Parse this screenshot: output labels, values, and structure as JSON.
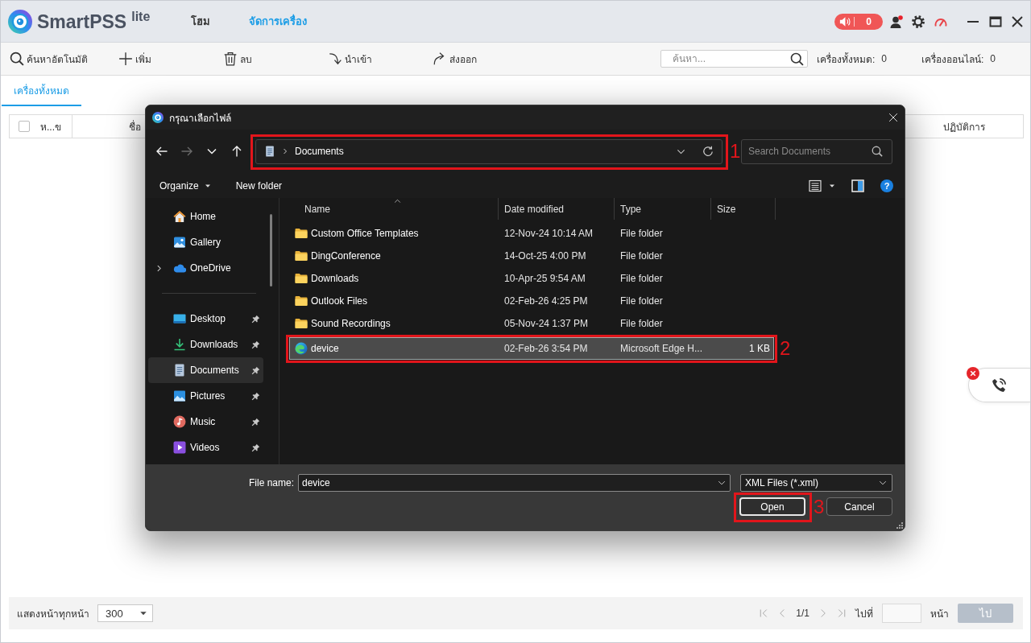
{
  "app": {
    "logo": "SmartPSS$^{lite}$",
    "nav_tabs": [
      {
        "label": "โฮม",
        "selected": false
      },
      {
        "label": "จัดการเครื่อง",
        "selected": true
      }
    ],
    "alarm_count": "0"
  },
  "toolbar": {
    "actions": [
      {
        "kind": "search",
        "label": "ค้นหาอัตโนมัติ"
      },
      {
        "kind": "add",
        "label": "เพิ่ม"
      },
      {
        "kind": "delete",
        "label": "ลบ"
      },
      {
        "kind": "import",
        "label": "นำเข้า"
      },
      {
        "kind": "export",
        "label": "ส่งออก"
      }
    ],
    "search": {
      "placeholder": "ค้นหา..."
    },
    "stats": [
      {
        "label": "เครื่องทั้งหมด:",
        "value": "0"
      },
      {
        "label": "เครื่องออนไลน์:",
        "value": "0"
      }
    ]
  },
  "tabs": [
    {
      "label": "เครื่องทั้งหมด",
      "selected": true
    }
  ],
  "table": {
    "select_all_checked": false,
    "columns": [
      "ห...ข",
      "ชื่อ",
      "ปฏิบัติการ"
    ]
  },
  "pagination": {
    "page_size_label": "แสดงหน้าทุกหน้า",
    "page_size": "300",
    "page": "1/1",
    "goto_label": "ไปที่",
    "page_unit": "หน้า",
    "go_button": {
      "label": "ไป",
      "disabled": true
    }
  },
  "file_dialog": {
    "title": "กรุณาเลือกไฟล์",
    "nav_buttons": [
      {
        "kind": "back",
        "disabled": false
      },
      {
        "kind": "forward",
        "disabled": true
      },
      {
        "kind": "recent",
        "disabled": false
      },
      {
        "kind": "up",
        "disabled": false
      }
    ],
    "address_bar": {
      "path": [
        "Documents"
      ],
      "callout": "1"
    },
    "search": {
      "placeholder": "Search Documents"
    },
    "commands": [
      {
        "label": "Organize",
        "has_menu": true
      },
      {
        "label": "New folder",
        "has_menu": false
      }
    ],
    "help": "?",
    "sidebar": {
      "sections": [
        {
          "items": [
            {
              "kind": "home",
              "label": "Home",
              "expandable": false,
              "pinned": false,
              "selected": false
            },
            {
              "kind": "gallery",
              "label": "Gallery",
              "expandable": false,
              "pinned": false,
              "selected": false
            },
            {
              "kind": "onedrive",
              "label": "OneDrive",
              "expandable": true,
              "pinned": false,
              "selected": false
            }
          ]
        },
        {
          "items": [
            {
              "kind": "desktop",
              "label": "Desktop",
              "expandable": false,
              "pinned": true,
              "selected": false
            },
            {
              "kind": "downloads",
              "label": "Downloads",
              "expandable": false,
              "pinned": true,
              "selected": false
            },
            {
              "kind": "documents",
              "label": "Documents",
              "expandable": false,
              "pinned": true,
              "selected": true
            },
            {
              "kind": "pictures",
              "label": "Pictures",
              "expandable": false,
              "pinned": true,
              "selected": false
            },
            {
              "kind": "music",
              "label": "Music",
              "expandable": false,
              "pinned": true,
              "selected": false
            },
            {
              "kind": "videos",
              "label": "Videos",
              "expandable": false,
              "pinned": true,
              "selected": false
            }
          ]
        }
      ]
    },
    "columns": [
      {
        "label": "Name",
        "sorted": true
      },
      {
        "label": "Date modified",
        "sorted": false
      },
      {
        "label": "Type",
        "sorted": false
      },
      {
        "label": "Size",
        "sorted": false
      }
    ],
    "files": [
      {
        "kind": "folder",
        "name": "Custom Office Templates",
        "date": "12-Nov-24 10:14 AM",
        "type": "File folder",
        "selected": false
      },
      {
        "kind": "folder",
        "name": "DingConference",
        "date": "14-Oct-25 4:00 PM",
        "type": "File folder",
        "selected": false
      },
      {
        "kind": "folder",
        "name": "Downloads",
        "date": "10-Apr-25 9:54 AM",
        "type": "File folder",
        "selected": false
      },
      {
        "kind": "folder",
        "name": "Outlook Files",
        "date": "02-Feb-26 4:25 PM",
        "type": "File folder",
        "selected": false
      },
      {
        "kind": "folder",
        "name": "Sound Recordings",
        "date": "05-Nov-24 1:37 PM",
        "type": "File folder",
        "selected": false
      },
      {
        "kind": "edge-document",
        "name": "device",
        "date": "02-Feb-26 3:54 PM",
        "type": "Microsoft Edge H...",
        "size": "1 KB",
        "selected": true,
        "callout": "2"
      }
    ],
    "file_name": {
      "label": "File name:",
      "value": "device"
    },
    "file_type": "XML Files (*.xml)",
    "buttons": [
      {
        "label": "Open",
        "default": true,
        "callout": "3"
      },
      {
        "label": "Cancel",
        "default": false
      }
    ]
  }
}
